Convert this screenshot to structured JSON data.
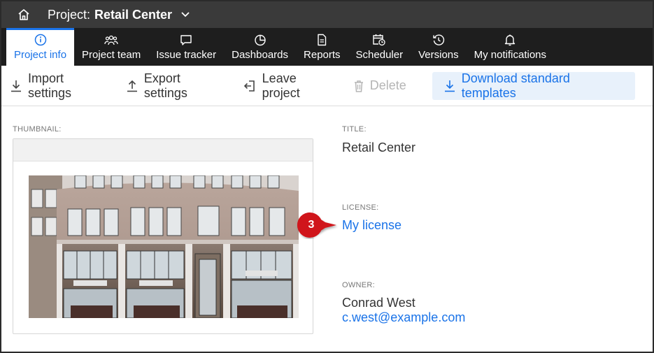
{
  "header": {
    "project_prefix": "Project:",
    "project_name": "Retail Center"
  },
  "tabs": [
    {
      "label": "Project info",
      "icon": "info-icon",
      "active": true
    },
    {
      "label": "Project team",
      "icon": "team-icon"
    },
    {
      "label": "Issue tracker",
      "icon": "chat-bubble-icon"
    },
    {
      "label": "Dashboards",
      "icon": "pie-chart-icon"
    },
    {
      "label": "Reports",
      "icon": "document-icon"
    },
    {
      "label": "Scheduler",
      "icon": "calendar-clock-icon"
    },
    {
      "label": "Versions",
      "icon": "history-icon"
    },
    {
      "label": "My notifications",
      "icon": "bell-icon"
    }
  ],
  "toolbar": {
    "import": "Import settings",
    "export": "Export settings",
    "leave": "Leave project",
    "delete": "Delete",
    "download": "Download standard templates"
  },
  "info": {
    "thumbnail_label": "THUMBNAIL:",
    "title_label": "TITLE:",
    "title_value": "Retail Center",
    "license_label": "LICENSE:",
    "license_value": "My license",
    "owner_label": "OWNER:",
    "owner_name": "Conrad West",
    "owner_email": "c.west@example.com"
  },
  "callout": {
    "number": "3",
    "color": "#d0151b"
  },
  "colors": {
    "accent": "#1a73e8",
    "titlebar": "#3a3a3a",
    "tabbar": "#1e1e1e"
  }
}
